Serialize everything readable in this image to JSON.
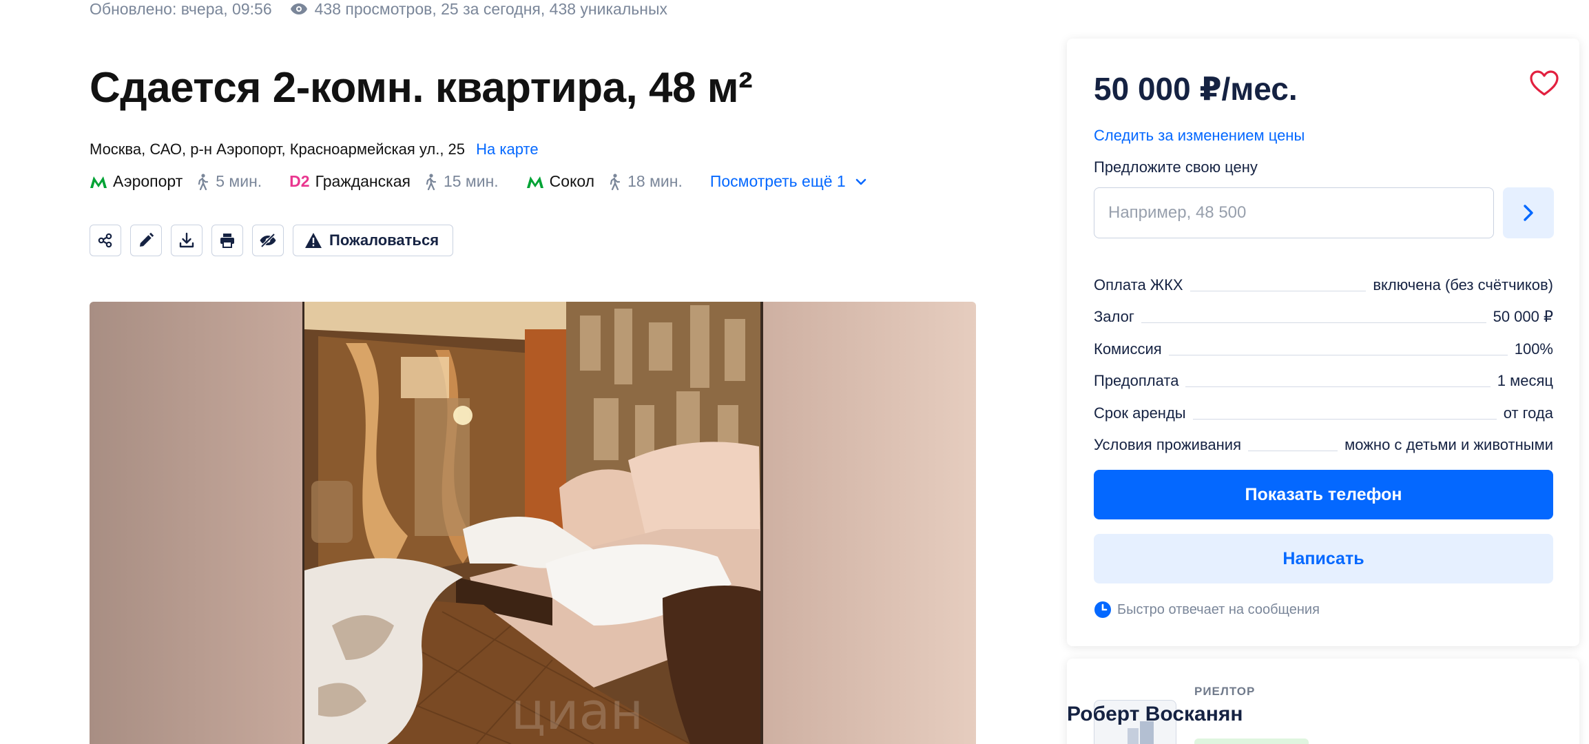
{
  "meta": {
    "updated": "Обновлено: вчера, 09:56",
    "views": "438 просмотров, 25 за сегодня, 438 уникальных"
  },
  "listing": {
    "title": "Сдается 2-комн. квартира, 48 м²",
    "address": "Москва, САО, р-н Аэропорт, Красноармейская ул., 25",
    "map_link": "На карте"
  },
  "metro": [
    {
      "icon": "metro-icon",
      "badge": "M",
      "name": "Аэропорт",
      "walk": "5 мин.",
      "color": "#00a335"
    },
    {
      "icon": "d2-icon",
      "badge": "D2",
      "name": "Гражданская",
      "walk": "15 мин.",
      "color": "#e9368f"
    },
    {
      "icon": "metro-icon",
      "badge": "M",
      "name": "Сокол",
      "walk": "18 мин.",
      "color": "#00a335"
    }
  ],
  "metro_more": "Посмотреть ещё 1",
  "toolbar": {
    "icons": [
      "share-icon",
      "edit-icon",
      "download-icon",
      "print-icon",
      "hide-icon"
    ],
    "complain": "Пожаловаться"
  },
  "photo": {
    "watermark": "циан"
  },
  "sidebar": {
    "price": "50 000 ₽/мес.",
    "watch_price": "Следить за изменением цены",
    "offer_label": "Предложите свою цену",
    "offer_placeholder": "Например, 48 500",
    "terms": [
      {
        "label": "Оплата ЖКХ",
        "value": "включена (без счётчиков)"
      },
      {
        "label": "Залог",
        "value": "50 000 ₽"
      },
      {
        "label": "Комиссия",
        "value": "100%"
      },
      {
        "label": "Предоплата",
        "value": "1 месяц"
      },
      {
        "label": "Срок аренды",
        "value": "от года"
      },
      {
        "label": "Условия проживания",
        "value": "можно с детьми и животными"
      }
    ],
    "show_phone": "Показать телефон",
    "write": "Написать",
    "reply_note": "Быстро отвечает на сообщения"
  },
  "agent": {
    "role": "РИЕЛТОР",
    "name": "Роберт Восканян"
  },
  "colors": {
    "primary": "#0468ff",
    "primary_light": "#e6f0ff",
    "heart": "#e2203f",
    "text": "#152242",
    "muted": "#7a8699"
  }
}
